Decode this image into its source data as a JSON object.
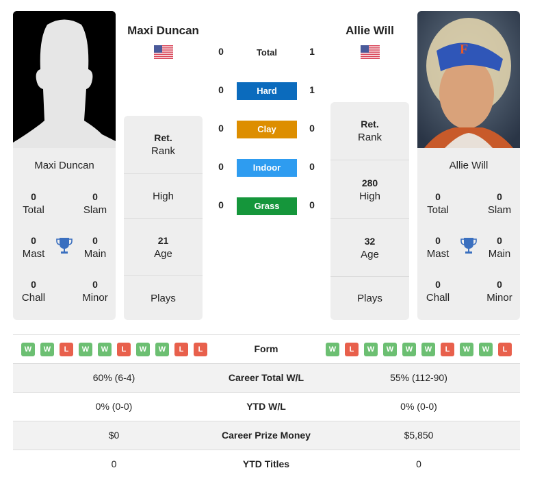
{
  "colors": {
    "hard": "#0b6bbd",
    "clay": "#dd8e00",
    "indoor": "#2e9cf0",
    "grass": "#15963b",
    "win": "#6cbf72",
    "loss": "#e8604c",
    "trophy": "#3a6fbf",
    "card_bg": "#eeeeee"
  },
  "player1": {
    "name": "Maxi Duncan",
    "flag_icon": "us-flag-icon",
    "card_name": "Maxi Duncan",
    "titles": {
      "total": {
        "value": "0",
        "label": "Total"
      },
      "slam": {
        "value": "0",
        "label": "Slam"
      },
      "mast": {
        "value": "0",
        "label": "Mast"
      },
      "main": {
        "value": "0",
        "label": "Main"
      },
      "chall": {
        "value": "0",
        "label": "Chall"
      },
      "minor": {
        "value": "0",
        "label": "Minor"
      }
    },
    "info": {
      "rank": {
        "value": "Ret.",
        "label": "Rank"
      },
      "high": {
        "value": "",
        "label": "High"
      },
      "age": {
        "value": "21",
        "label": "Age"
      },
      "plays": {
        "value": "",
        "label": "Plays"
      }
    },
    "form": [
      "W",
      "W",
      "L",
      "W",
      "W",
      "L",
      "W",
      "W",
      "L",
      "L"
    ]
  },
  "player2": {
    "name": "Allie Will",
    "flag_icon": "us-flag-icon",
    "card_name": "Allie Will",
    "titles": {
      "total": {
        "value": "0",
        "label": "Total"
      },
      "slam": {
        "value": "0",
        "label": "Slam"
      },
      "mast": {
        "value": "0",
        "label": "Mast"
      },
      "main": {
        "value": "0",
        "label": "Main"
      },
      "chall": {
        "value": "0",
        "label": "Chall"
      },
      "minor": {
        "value": "0",
        "label": "Minor"
      }
    },
    "info": {
      "rank": {
        "value": "Ret.",
        "label": "Rank"
      },
      "high": {
        "value": "280",
        "label": "High"
      },
      "age": {
        "value": "32",
        "label": "Age"
      },
      "plays": {
        "value": "",
        "label": "Plays"
      }
    },
    "form": [
      "W",
      "L",
      "W",
      "W",
      "W",
      "W",
      "L",
      "W",
      "W",
      "L"
    ]
  },
  "h2h": {
    "total": {
      "label": "Total",
      "p1": "0",
      "p2": "1"
    },
    "hard": {
      "label": "Hard",
      "p1": "0",
      "p2": "1"
    },
    "clay": {
      "label": "Clay",
      "p1": "0",
      "p2": "0"
    },
    "indoor": {
      "label": "Indoor",
      "p1": "0",
      "p2": "0"
    },
    "grass": {
      "label": "Grass",
      "p1": "0",
      "p2": "0"
    }
  },
  "comparison": {
    "form_label": "Form",
    "rows": [
      {
        "label": "Career Total W/L",
        "p1": "60% (6-4)",
        "p2": "55% (112-90)"
      },
      {
        "label": "YTD W/L",
        "p1": "0% (0-0)",
        "p2": "0% (0-0)"
      },
      {
        "label": "Career Prize Money",
        "p1": "$0",
        "p2": "$5,850"
      },
      {
        "label": "YTD Titles",
        "p1": "0",
        "p2": "0"
      }
    ]
  }
}
